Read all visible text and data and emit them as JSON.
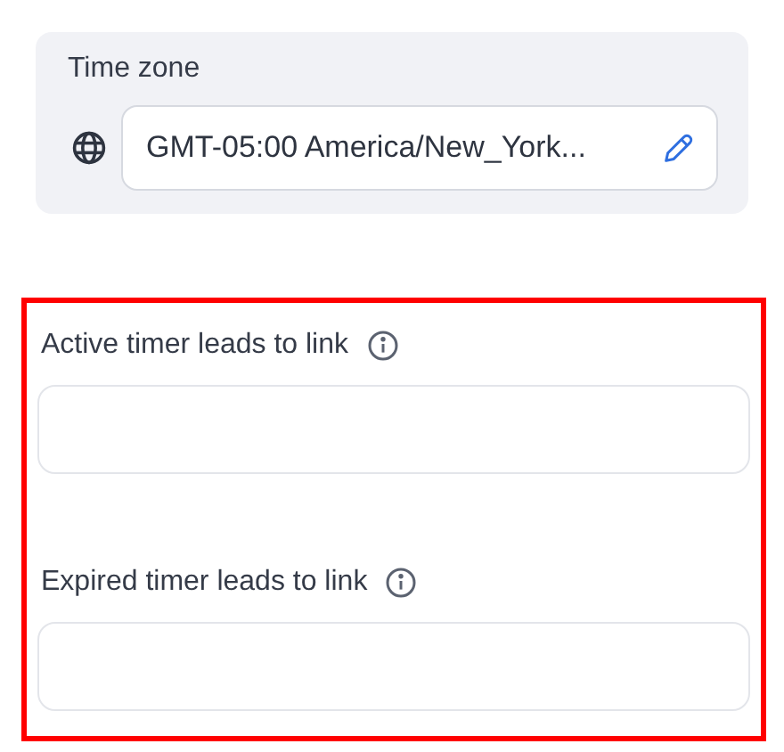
{
  "time_zone": {
    "label": "Time zone",
    "value": "GMT-05:00 America/New_York..."
  },
  "link_fields": [
    {
      "label": "Active timer leads to link"
    },
    {
      "label": "Expired timer leads to link"
    }
  ]
}
